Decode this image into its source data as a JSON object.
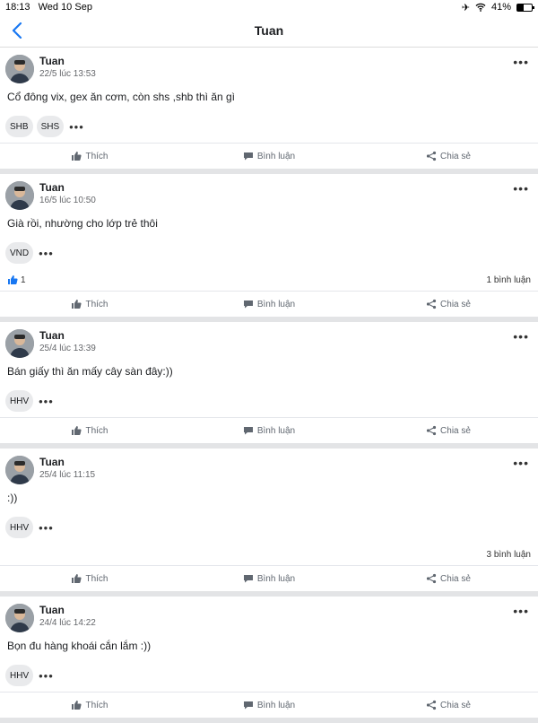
{
  "status": {
    "time": "18:13",
    "date": "Wed 10 Sep",
    "battery": "41%",
    "battery_level": 0.41
  },
  "nav": {
    "title": "Tuan"
  },
  "actions": {
    "like": "Thích",
    "comment": "Bình luận",
    "share": "Chia sẻ"
  },
  "posts": [
    {
      "author": "Tuan",
      "time": "22/5 lúc 13:53",
      "text": "Cổ đông vix, gex ăn cơm, còn shs ,shb thì ăn gì",
      "tags": [
        "SHB",
        "SHS"
      ]
    },
    {
      "author": "Tuan",
      "time": "16/5 lúc 10:50",
      "text": "Già rồi, nhường cho lớp trẻ thôi",
      "tags": [
        "VND"
      ],
      "likes": "1",
      "comments": "1 bình luận"
    },
    {
      "author": "Tuan",
      "time": "25/4 lúc 13:39",
      "text": "Bán giấy thì ăn mấy cây sàn đây:))",
      "tags": [
        "HHV"
      ]
    },
    {
      "author": "Tuan",
      "time": "25/4 lúc 11:15",
      "text": ":))",
      "tags": [
        "HHV"
      ],
      "comments": "3 bình luận"
    },
    {
      "author": "Tuan",
      "time": "24/4 lúc 14:22",
      "text": "Bọn đu hàng khoái cắn lắm :))",
      "tags": [
        "HHV"
      ]
    }
  ]
}
